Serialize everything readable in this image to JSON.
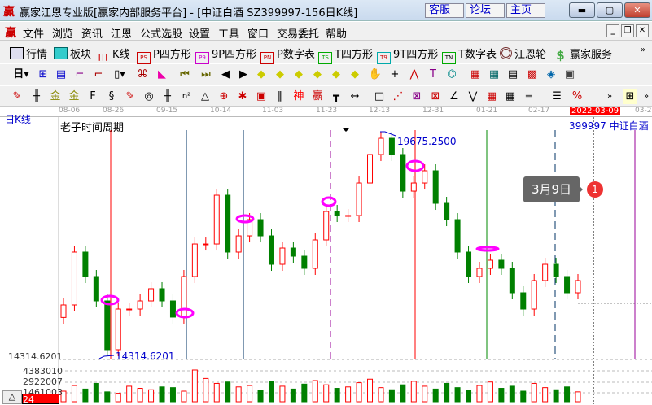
{
  "window": {
    "title": "赢家江恩专业版[赢家内部服务平台] - [中证白酒   SZ399997-156日K线]",
    "links": [
      "客服",
      "论坛",
      "主页"
    ],
    "logo": "赢"
  },
  "menu": [
    "文件",
    "浏览",
    "资讯",
    "江恩",
    "公式选股",
    "设置",
    "工具",
    "窗口",
    "交易委托",
    "帮助"
  ],
  "toolbar1": [
    {
      "label": "行情",
      "icon": "table-icon"
    },
    {
      "label": "板块",
      "icon": "grid-icon"
    },
    {
      "label": "K线",
      "icon": "candles-icon"
    },
    {
      "label": "P四方形",
      "icon": "PS"
    },
    {
      "label": "9P四方形",
      "icon": "P9"
    },
    {
      "label": "P数字表",
      "icon": "PN"
    },
    {
      "label": "T四方形",
      "icon": "TS"
    },
    {
      "label": "9T四方形",
      "icon": "T9"
    },
    {
      "label": "T数字表",
      "icon": "TN"
    },
    {
      "label": "江恩轮",
      "icon": "wheel-icon"
    },
    {
      "label": "赢家服务",
      "icon": "dollar-icon"
    }
  ],
  "toolbar2": {
    "period": "日"
  },
  "axis": {
    "dates": [
      "08-06",
      "08-26",
      "09-15",
      "10-14",
      "11-03",
      "11-23",
      "12-13",
      "12-31",
      "01-21",
      "02-17",
      "03-2"
    ],
    "current_date": "2022-03-09"
  },
  "chart": {
    "period_label": "日K线",
    "study": "老子时间周期",
    "code": "399997",
    "name": "中证白酒",
    "high_label": "19675.2500",
    "low_label": "14314.6201",
    "low_axis": "14314.6201",
    "tooltip": "3月9日",
    "badge": "1",
    "vol_ticks": [
      "4383010",
      "2922007",
      "1461003"
    ],
    "bottom_value": "24",
    "triangle": "△"
  },
  "chart_data": {
    "type": "candlestick",
    "price_range": [
      14314.6201,
      19675.25
    ],
    "closes": [
      15582,
      16849,
      16264,
      15679,
      14510,
      15484,
      15484,
      15679,
      15972,
      15679,
      15290,
      16264,
      17043,
      17043,
      18213,
      16849,
      17238,
      17628,
      17238,
      16556,
      16946,
      16751,
      16459,
      17141,
      17823,
      17726,
      17726,
      18505,
      19188,
      19577,
      19188,
      18310,
      18505,
      18798,
      18018,
      17628,
      16849,
      16264,
      16459,
      16654,
      16459,
      15874,
      15484,
      16167,
      16556,
      16264,
      15874,
      16167
    ],
    "volumes": [
      1500000,
      2300000,
      1800000,
      2600000,
      1400000,
      1200000,
      2200000,
      1900000,
      1700000,
      2100000,
      2000000,
      1500000,
      4500000,
      3300000,
      2600000,
      2800000,
      2100000,
      2300000,
      1600000,
      2900000,
      2200000,
      1800000,
      2500000,
      3000000,
      2400000,
      1900000,
      2100000,
      2700000,
      3200000,
      2000000,
      1700000,
      2400000,
      2900000,
      2200000,
      1800000,
      2600000,
      2000000,
      1600000,
      2300000,
      2800000,
      1900000,
      2200000,
      1500000,
      2600000,
      2000000,
      1700000,
      2100000,
      1400000
    ],
    "up_color": "#ff0000",
    "down_color": "#008000"
  }
}
